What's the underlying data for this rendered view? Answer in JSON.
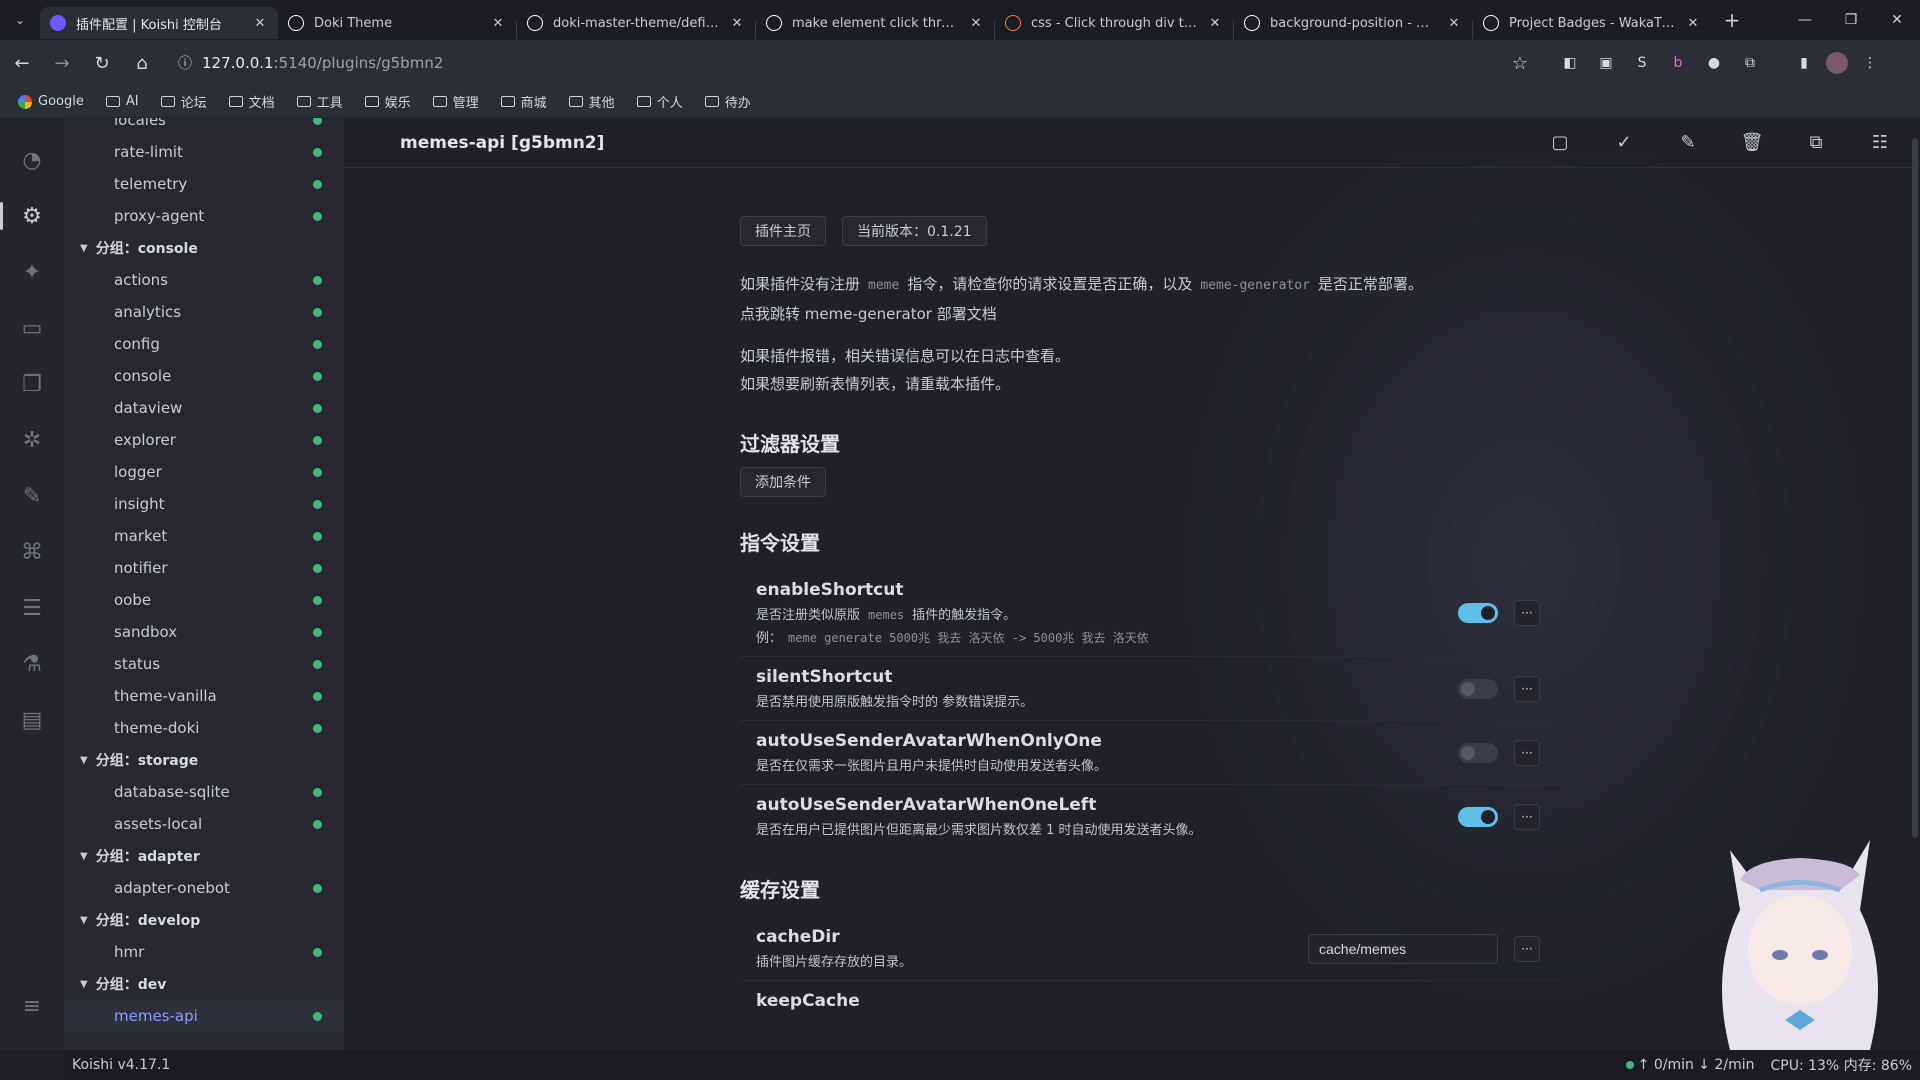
{
  "browser": {
    "tabs": [
      {
        "title": "插件配置 | Koishi 控制台",
        "active": true,
        "favicon": "koishi-icon",
        "color": "#6b5cff"
      },
      {
        "title": "Doki Theme",
        "active": false,
        "favicon": "github-icon",
        "color": "#ffffff"
      },
      {
        "title": "doki-master-theme/definitio",
        "active": false,
        "favicon": "github-icon",
        "color": "#ffffff"
      },
      {
        "title": "make element click through",
        "active": false,
        "favicon": "google-icon",
        "color": "#ffffff"
      },
      {
        "title": "css - Click through div to unc",
        "active": false,
        "favicon": "stackoverflow-icon",
        "color": "#f48024"
      },
      {
        "title": "background-position - CSS: t",
        "active": false,
        "favicon": "mdn-icon",
        "color": "#ffffff"
      },
      {
        "title": "Project Badges - WakaTime",
        "active": false,
        "favicon": "wakatime-icon",
        "color": "#ffffff"
      }
    ],
    "url_host": "127.0.0.1",
    "url_path": ":5140/plugins/g5bmn2",
    "bookmarks": [
      "Google",
      "AI",
      "论坛",
      "文档",
      "工具",
      "娱乐",
      "管理",
      "商城",
      "其他",
      "个人",
      "待办"
    ]
  },
  "sidebar": {
    "items": [
      {
        "type": "item",
        "label": "locales"
      },
      {
        "type": "item",
        "label": "rate-limit"
      },
      {
        "type": "item",
        "label": "telemetry"
      },
      {
        "type": "item",
        "label": "proxy-agent"
      },
      {
        "type": "group",
        "label": "分组：console"
      },
      {
        "type": "item",
        "label": "actions"
      },
      {
        "type": "item",
        "label": "analytics"
      },
      {
        "type": "item",
        "label": "config"
      },
      {
        "type": "item",
        "label": "console"
      },
      {
        "type": "item",
        "label": "dataview"
      },
      {
        "type": "item",
        "label": "explorer"
      },
      {
        "type": "item",
        "label": "logger"
      },
      {
        "type": "item",
        "label": "insight"
      },
      {
        "type": "item",
        "label": "market"
      },
      {
        "type": "item",
        "label": "notifier"
      },
      {
        "type": "item",
        "label": "oobe"
      },
      {
        "type": "item",
        "label": "sandbox"
      },
      {
        "type": "item",
        "label": "status"
      },
      {
        "type": "item",
        "label": "theme-vanilla"
      },
      {
        "type": "item",
        "label": "theme-doki"
      },
      {
        "type": "group",
        "label": "分组：storage"
      },
      {
        "type": "item",
        "label": "database-sqlite"
      },
      {
        "type": "item",
        "label": "assets-local"
      },
      {
        "type": "group",
        "label": "分组：adapter"
      },
      {
        "type": "item",
        "label": "adapter-onebot"
      },
      {
        "type": "group",
        "label": "分组：develop"
      },
      {
        "type": "item",
        "label": "hmr"
      },
      {
        "type": "group",
        "label": "分组：dev"
      },
      {
        "type": "item",
        "label": "memes-api",
        "active": true
      }
    ]
  },
  "header": {
    "title": "memes-api [g5bmn2]"
  },
  "main": {
    "chips": [
      "插件主页",
      "当前版本：0.1.21"
    ],
    "p1_a": "如果插件没有注册",
    "p1_code1": "meme",
    "p1_b": "指令，请检查你的请求设置是否正确，以及",
    "p1_code2": "meme-generator",
    "p1_c": "是否正常部署。",
    "p1_link": "点我跳转 meme-generator 部署文档",
    "p2_line1": "如果插件报错，相关错误信息可以在日志中查看。",
    "p2_line2": "如果想要刷新表情列表，请重载本插件。",
    "filter_title": "过滤器设置",
    "add_condition": "添加条件",
    "command_title": "指令设置",
    "cache_title": "缓存设置",
    "commands": [
      {
        "name": "enableShortcut",
        "desc_a": "是否注册类似原版",
        "desc_code": "memes",
        "desc_b": "插件的触发指令。",
        "eg_label": "例：",
        "eg_code": "meme generate 5000兆 我去 洛天依  ->  5000兆 我去 洛天依",
        "on": true
      },
      {
        "name": "silentShortcut",
        "desc_a": "是否禁用使用原版触发指令时的 参数错误提示。",
        "on": false
      },
      {
        "name": "autoUseSenderAvatarWhenOnlyOne",
        "desc_a": "是否在仅需求一张图片且用户未提供时自动使用发送者头像。",
        "on": false
      },
      {
        "name": "autoUseSenderAvatarWhenOneLeft",
        "desc_a": "是否在用户已提供图片但距离最少需求图片数仅差 1 时自动使用发送者头像。",
        "on": true
      }
    ],
    "cache": [
      {
        "name": "cacheDir",
        "desc": "插件图片缓存存放的目录。",
        "value": "cache/memes"
      },
      {
        "name": "keepCache",
        "desc": ""
      }
    ],
    "more_label": "···"
  },
  "status": {
    "version": "Koishi v4.17.1",
    "rates": "↑ 0/min ↓ 2/min",
    "cpu": "CPU: 13% 内存: 86%"
  }
}
